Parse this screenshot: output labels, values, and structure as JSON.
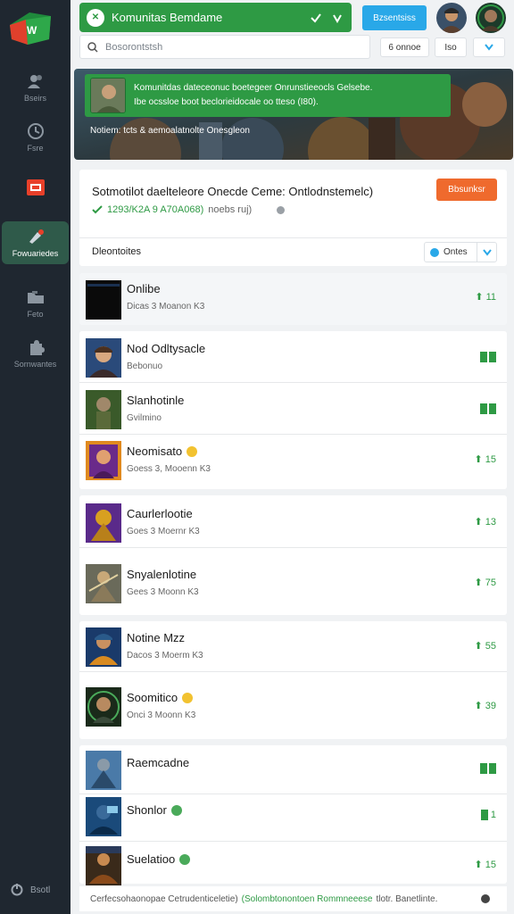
{
  "sidebar": {
    "items": [
      {
        "label": "Bseirs",
        "icon": "users-icon"
      },
      {
        "label": "Fsre",
        "icon": "clock-icon"
      },
      {
        "label": "",
        "icon": "calendar-icon"
      },
      {
        "label": "Fowuariedes",
        "icon": "rocket-icon",
        "active": true
      },
      {
        "label": "Feto",
        "icon": "folder-icon"
      },
      {
        "label": "Sornwantes",
        "icon": "puzzle-icon"
      }
    ],
    "footer_label": "Bsotl"
  },
  "topbar": {
    "title": "Komunitas Bemdame",
    "button_label": "Bzsentsiss",
    "search_placeholder": "Bosorontstsh",
    "tool1_label": "6 onnoe",
    "tool2_label": "Iso"
  },
  "banner": {
    "line1": "Komunitdas dateceonuc boetegeer Onrunstieeocls Gelsebe.",
    "line2": "Ibe ocssloe boot beclorieidocale oo tteso (I80).",
    "note": "Notiem: tcts & aemoalatnolte Onesgleon"
  },
  "card": {
    "title": "Sotmotilot daelteleore Onecde Ceme: Ontlodnstemelc)",
    "sub_green": "1293/K2A 9 A70A068)",
    "sub_rest": "noebs ruj)",
    "button_label": "Bbsunksr",
    "list_header": "Dleontoites",
    "select_label": "Ontes"
  },
  "rows": [
    {
      "name": "Onlibe",
      "sub": "Dicas 3 Moanon K3",
      "stat": "11",
      "type": "arrow"
    },
    {
      "name": "Nod Odltysacle",
      "sub": "Bebonuo",
      "stat": "",
      "type": "bars"
    },
    {
      "name": "Slanhotinle",
      "sub": "Gvilmino",
      "stat": "",
      "type": "bars"
    },
    {
      "name": "Neomisato",
      "sub": "Goess 3, Mooenn K3",
      "stat": "15",
      "type": "arrow"
    },
    {
      "name": "Caurlerlootie",
      "sub": "Goes 3 Moernr K3",
      "stat": "13",
      "type": "arrow"
    },
    {
      "name": "Snyalenlotine",
      "sub": "Gees 3 Moonn K3",
      "stat": "75",
      "type": "arrow"
    },
    {
      "name": "Notine Mzz",
      "sub": "Dacos 3 Moerm K3",
      "stat": "55",
      "type": "arrow"
    },
    {
      "name": "Soomitico",
      "sub": "Onci 3 Moonn K3",
      "stat": "39",
      "type": "arrow"
    },
    {
      "name": "Raemcadne",
      "sub": "",
      "stat": "",
      "type": "bars"
    },
    {
      "name": "Shonlor",
      "sub": "",
      "stat": "1",
      "type": "bars1"
    },
    {
      "name": "Suelatioo",
      "sub": "",
      "stat": "15",
      "type": "arrow"
    }
  ],
  "footer": {
    "part1": "Cerfecsohaonopae Cetrudenticeletie)",
    "part2": "(Solombtonontoen Rommneeese",
    "part3": "tlotr. Banetlinte."
  },
  "colors": {
    "green": "#2e9a44",
    "blue": "#29a8e8",
    "orange": "#ef6a2d",
    "sidebar": "#1f2730"
  }
}
